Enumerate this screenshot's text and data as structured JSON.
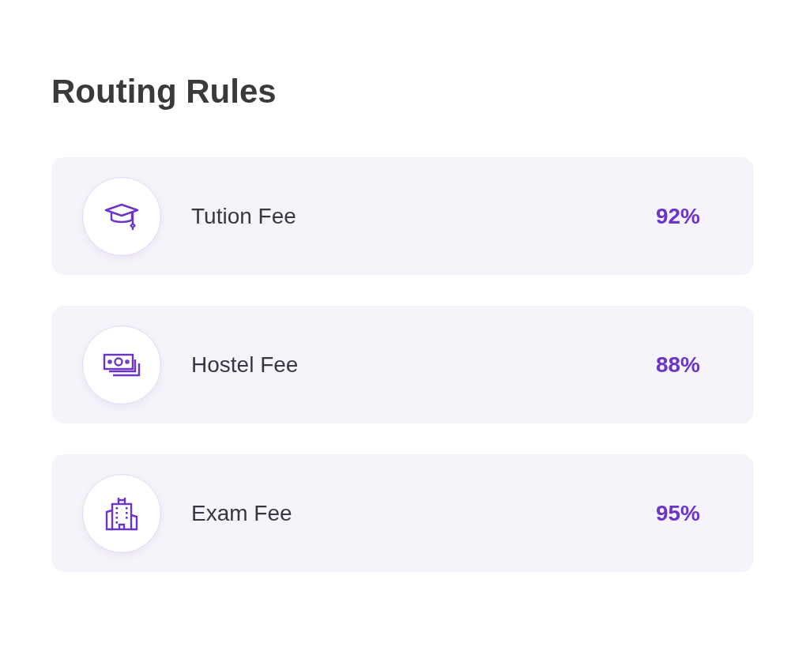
{
  "title": "Routing Rules",
  "rules": [
    {
      "name": "Tution Fee",
      "value": "92%"
    },
    {
      "name": "Hostel Fee",
      "value": "88%"
    },
    {
      "name": "Exam Fee",
      "value": "95%"
    }
  ]
}
